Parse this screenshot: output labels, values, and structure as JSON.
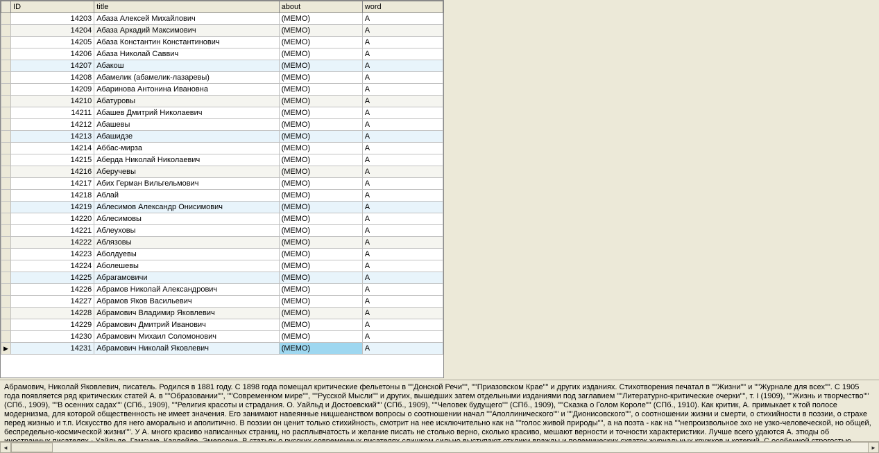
{
  "columns": {
    "id": "ID",
    "title": "title",
    "about": "about",
    "word": "word"
  },
  "rows": [
    {
      "id": "14203",
      "title": "Абаза Алексей Михайлович",
      "about": "(MEMO)",
      "word": "А",
      "alt": false,
      "hl": false
    },
    {
      "id": "14204",
      "title": "Абаза Аркадий Максимович",
      "about": "(MEMO)",
      "word": "А",
      "alt": true,
      "hl": false
    },
    {
      "id": "14205",
      "title": "Абаза Константин Константинович",
      "about": "(MEMO)",
      "word": "А",
      "alt": false,
      "hl": false
    },
    {
      "id": "14206",
      "title": "Абаза Николай Саввич",
      "about": "(MEMO)",
      "word": "А",
      "alt": false,
      "hl": false
    },
    {
      "id": "14207",
      "title": "Абакош",
      "about": "(MEMO)",
      "word": "А",
      "alt": false,
      "hl": true
    },
    {
      "id": "14208",
      "title": "Абамелик (абамелик-лазаревы)",
      "about": "(MEMO)",
      "word": "А",
      "alt": false,
      "hl": false
    },
    {
      "id": "14209",
      "title": "Абаринова Антонина Ивановна",
      "about": "(MEMO)",
      "word": "А",
      "alt": false,
      "hl": false
    },
    {
      "id": "14210",
      "title": "Абатуровы",
      "about": "(MEMO)",
      "word": "А",
      "alt": true,
      "hl": false
    },
    {
      "id": "14211",
      "title": "Абашев Дмитрий Николаевич",
      "about": "(MEMO)",
      "word": "А",
      "alt": false,
      "hl": false
    },
    {
      "id": "14212",
      "title": "Абашевы",
      "about": "(MEMO)",
      "word": "А",
      "alt": false,
      "hl": false
    },
    {
      "id": "14213",
      "title": "Абашидзе",
      "about": "(MEMO)",
      "word": "А",
      "alt": false,
      "hl": true
    },
    {
      "id": "14214",
      "title": "Аббас-мирза",
      "about": "(MEMO)",
      "word": "А",
      "alt": false,
      "hl": false
    },
    {
      "id": "14215",
      "title": "Аберда Николай Николаевич",
      "about": "(MEMO)",
      "word": "А",
      "alt": false,
      "hl": false
    },
    {
      "id": "14216",
      "title": "Аберучевы",
      "about": "(MEMO)",
      "word": "А",
      "alt": true,
      "hl": false
    },
    {
      "id": "14217",
      "title": "Абих Герман Вильгельмович",
      "about": "(MEMO)",
      "word": "А",
      "alt": false,
      "hl": false
    },
    {
      "id": "14218",
      "title": "Аблай",
      "about": "(MEMO)",
      "word": "А",
      "alt": false,
      "hl": false
    },
    {
      "id": "14219",
      "title": "Аблесимов Александр Онисимович",
      "about": "(MEMO)",
      "word": "А",
      "alt": false,
      "hl": true
    },
    {
      "id": "14220",
      "title": "Аблесимовы",
      "about": "(MEMO)",
      "word": "А",
      "alt": false,
      "hl": false
    },
    {
      "id": "14221",
      "title": "Аблеуховы",
      "about": "(MEMO)",
      "word": "А",
      "alt": false,
      "hl": false
    },
    {
      "id": "14222",
      "title": "Аблязовы",
      "about": "(MEMO)",
      "word": "А",
      "alt": true,
      "hl": false
    },
    {
      "id": "14223",
      "title": "Аболдуевы",
      "about": "(MEMO)",
      "word": "А",
      "alt": false,
      "hl": false
    },
    {
      "id": "14224",
      "title": "Аболешевы",
      "about": "(MEMO)",
      "word": "А",
      "alt": false,
      "hl": false
    },
    {
      "id": "14225",
      "title": "Абрагамовичи",
      "about": "(MEMO)",
      "word": "А",
      "alt": false,
      "hl": true
    },
    {
      "id": "14226",
      "title": "Абрамов Николай Александрович",
      "about": "(MEMO)",
      "word": "А",
      "alt": false,
      "hl": false
    },
    {
      "id": "14227",
      "title": "Абрамов Яков Васильевич",
      "about": "(MEMO)",
      "word": "А",
      "alt": false,
      "hl": false
    },
    {
      "id": "14228",
      "title": "Абрамович Владимир Яковлевич",
      "about": "(MEMO)",
      "word": "А",
      "alt": true,
      "hl": false
    },
    {
      "id": "14229",
      "title": "Абрамович Дмитрий Иванович",
      "about": "(MEMO)",
      "word": "А",
      "alt": false,
      "hl": false
    },
    {
      "id": "14230",
      "title": "Абрамович Михаил Соломонович",
      "about": "(MEMO)",
      "word": "А",
      "alt": false,
      "hl": false
    },
    {
      "id": "14231",
      "title": "Абрамович Николай Яковлевич",
      "about": "(MEMO)",
      "word": "А",
      "alt": false,
      "hl": false,
      "selected": true
    }
  ],
  "detail_text": "Абрамович, Николай Яковлевич, писатель. Родился в 1881 году. С 1898 года помещал критические фельетоны в \"\"Донской Речи\"\", \"\"Приазовском Крае\"\" и других изданиях. Стихотворения печатал в \"\"Жизни\"\" и \"\"Журнале для всех\"\". С 1905 года появляется ряд критических статей А. в \"\"Образовании\"\", \"\"Современном мире\"\", \"\"Русской Мысли\"\" и других, вышедших затем отдельными изданиями под заглавием \"\"Литературно-критические очерки\"\", т. I (1909), \"\"Жизнь и творчество\"\" (СПб., 1909), \"\"В осенних садах\"\" (СПб., 1909), \"\"Религия красоты и страдания. О. Уайльд и Достоевский\"\" (СПб., 1909), \"\"Человек будущего\"\" (СПб., 1909), \"\"Сказка о Голом Короле\"\" (СПб., 1910). Как критик, А. примыкает к той полосе модернизма, для которой общественность не имеет значения. Его занимают навеянные ницшеанством вопросы о соотношении начал \"\"Аполлинического\"\" и \"\"Дионисовского\"\", о соотношении жизни и смерти, о стихийности в поэзии, о страхе перед жизнью и т.п. Искусство для него аморально и аполитично. В поэзии он ценит только стихийность, смотрит на нее исключительно как на \"\"голос живой природы\"\", а на поэта - как на \"\"непроизвольное эхо не узко-человеческой, но общей, беспредельно-космической жизни\"\". У А. много красиво написанных страниц, но расплывчатость и желание писать не столько верно, сколько красиво, мешают верности и точности характеристики. Лучше всего удаются А. этюды об иностранных писателях - Уайльде, Гамсуне, Карлейле, Эмерсоне. В статьях о русских современных писателях слишком сильно выступают отклики вражды и полемических схваток журнальных кружков и котерий. С особенной строгостью"
}
